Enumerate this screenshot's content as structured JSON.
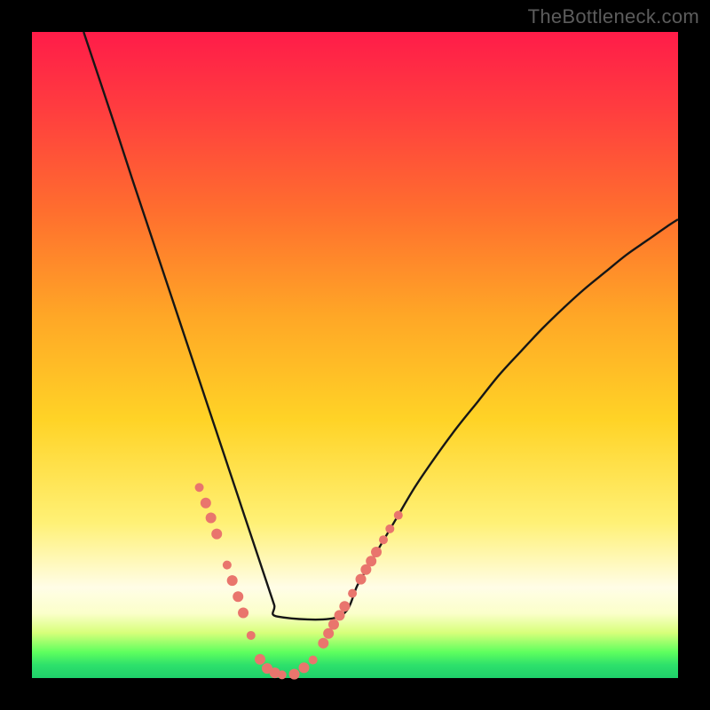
{
  "watermark": "TheBottleneck.com",
  "colors": {
    "background": "#000000",
    "curve_stroke": "#161616",
    "marker_fill": "#e9756d",
    "gradient_top": "#ff1c49",
    "gradient_bottom": "#1fd06a"
  },
  "chart_data": {
    "type": "line",
    "title": "",
    "xlabel": "",
    "ylabel": "",
    "xlim": [
      0,
      100
    ],
    "ylim": [
      0,
      100
    ],
    "grid": false,
    "series": [
      {
        "name": "bottleneck-curve",
        "x": [
          8,
          12.8,
          15.5,
          17.7,
          19.8,
          21.7,
          23.5,
          25.3,
          27.3,
          28.5,
          29.7,
          30.8,
          31.9,
          33,
          34.1,
          35.2,
          36.3,
          37.5,
          38.1,
          47.5,
          50.5,
          53.4,
          56.4,
          59.3,
          62.5,
          65.8,
          69.1,
          72.3,
          75.8,
          79,
          82.3,
          85.5,
          88.8,
          92,
          95.3,
          98.6,
          100
        ],
        "y": [
          100,
          85.6,
          77.3,
          70.7,
          64.4,
          58.7,
          53.3,
          47.9,
          41.9,
          38.3,
          34.7,
          31.4,
          28.1,
          24.8,
          21.5,
          18.2,
          14.9,
          11.3,
          9.5,
          9.5,
          14.6,
          19.6,
          24.7,
          29.6,
          34.3,
          38.8,
          42.9,
          46.9,
          50.7,
          54.1,
          57.3,
          60.2,
          62.9,
          65.5,
          67.8,
          70.1,
          71
        ],
        "comment": "y is relative height 0-100 from bottom of plot-area; 0=bottom"
      }
    ],
    "markers": [
      {
        "x": 25.9,
        "y": 29.5,
        "r": 5
      },
      {
        "x": 26.9,
        "y": 27.1,
        "r": 6
      },
      {
        "x": 27.7,
        "y": 24.8,
        "r": 6
      },
      {
        "x": 28.6,
        "y": 22.3,
        "r": 6
      },
      {
        "x": 30.2,
        "y": 17.5,
        "r": 5
      },
      {
        "x": 31.0,
        "y": 15.1,
        "r": 6
      },
      {
        "x": 31.9,
        "y": 12.6,
        "r": 6
      },
      {
        "x": 32.7,
        "y": 10.1,
        "r": 6
      },
      {
        "x": 33.9,
        "y": 6.6,
        "r": 5
      },
      {
        "x": 35.3,
        "y": 2.9,
        "r": 6
      },
      {
        "x": 36.4,
        "y": 1.5,
        "r": 6
      },
      {
        "x": 37.6,
        "y": 0.8,
        "r": 6
      },
      {
        "x": 38.7,
        "y": 0.5,
        "r": 5
      },
      {
        "x": 40.6,
        "y": 0.6,
        "r": 6
      },
      {
        "x": 42.1,
        "y": 1.6,
        "r": 6
      },
      {
        "x": 43.5,
        "y": 2.8,
        "r": 5
      },
      {
        "x": 45.1,
        "y": 5.4,
        "r": 6
      },
      {
        "x": 45.9,
        "y": 6.9,
        "r": 6
      },
      {
        "x": 46.7,
        "y": 8.3,
        "r": 6
      },
      {
        "x": 47.6,
        "y": 9.7,
        "r": 6
      },
      {
        "x": 48.4,
        "y": 11.1,
        "r": 6
      },
      {
        "x": 49.6,
        "y": 13.1,
        "r": 5
      },
      {
        "x": 50.9,
        "y": 15.3,
        "r": 6
      },
      {
        "x": 51.7,
        "y": 16.8,
        "r": 6
      },
      {
        "x": 52.5,
        "y": 18.1,
        "r": 6
      },
      {
        "x": 53.3,
        "y": 19.5,
        "r": 6
      },
      {
        "x": 54.4,
        "y": 21.4,
        "r": 5
      },
      {
        "x": 55.4,
        "y": 23.1,
        "r": 5
      },
      {
        "x": 56.7,
        "y": 25.2,
        "r": 5
      }
    ],
    "marker_comment": "x,y in same 0-100 coord space; r is marker radius in px"
  }
}
